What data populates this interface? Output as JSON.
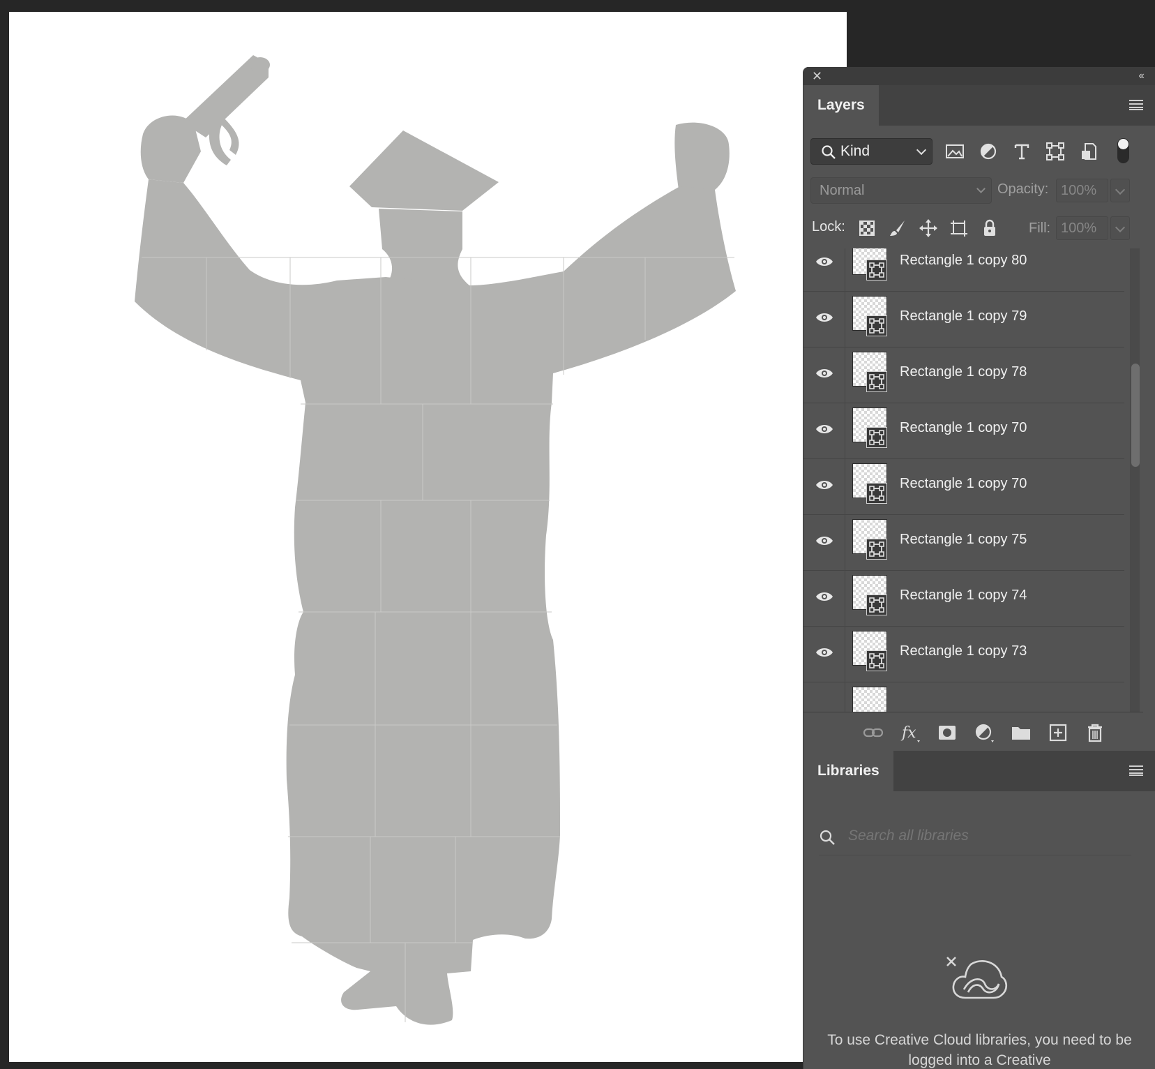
{
  "panel": {
    "layers_tab": "Layers",
    "filter_kind": "Kind",
    "blend_mode": "Normal",
    "opacity_label": "Opacity:",
    "opacity_value": "100%",
    "lock_label": "Lock:",
    "fill_label": "Fill:",
    "fill_value": "100%",
    "layers": [
      "Rectangle 1 copy 80",
      "Rectangle 1 copy 79",
      "Rectangle 1 copy 78",
      "Rectangle 1 copy 70",
      "Rectangle 1 copy 70",
      "Rectangle 1 copy 75",
      "Rectangle 1 copy 74",
      "Rectangle 1 copy 73"
    ]
  },
  "libraries": {
    "tab": "Libraries",
    "search_placeholder": "Search all libraries",
    "message": "To use Creative Cloud libraries, you need to be logged into a Creative"
  },
  "colors": {
    "silhouette": "#b3b3b1",
    "panel_bg": "#535353",
    "app_bg": "#262626"
  },
  "icons": [
    "close-icon",
    "collapse-icon",
    "menu-icon",
    "search-icon",
    "image-filter-icon",
    "adjustment-filter-icon",
    "type-filter-icon",
    "shape-filter-icon",
    "smart-object-filter-icon",
    "filter-toggle",
    "lock-pixels-icon",
    "lock-paint-icon",
    "lock-position-icon",
    "lock-artboard-icon",
    "lock-all-icon",
    "visibility-eye-icon",
    "link-icon",
    "fx-icon",
    "mask-icon",
    "adjustment-icon",
    "folder-icon",
    "new-layer-icon",
    "trash-icon",
    "creative-cloud-icon"
  ]
}
